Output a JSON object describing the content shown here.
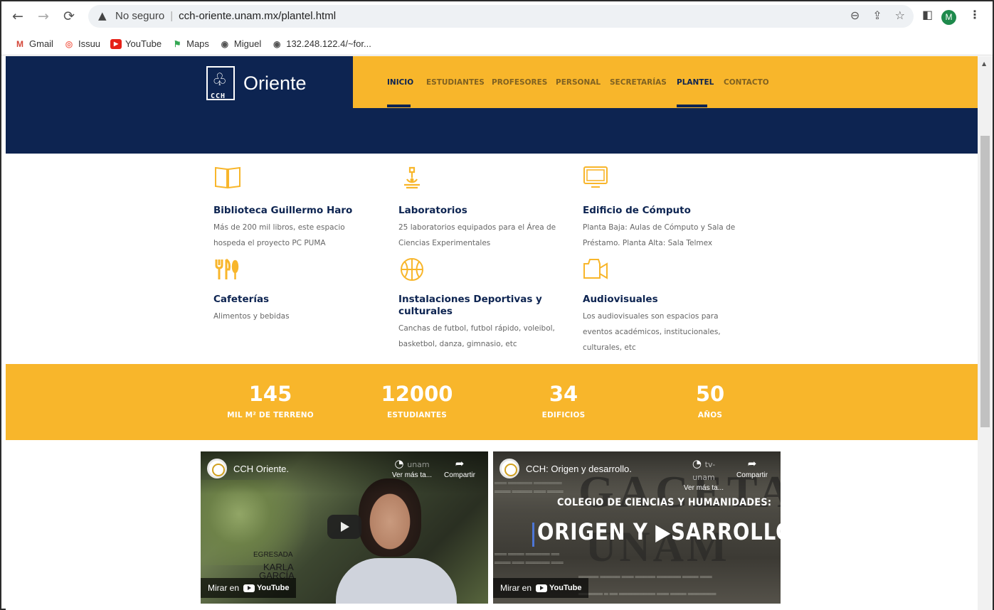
{
  "browser": {
    "security_label": "No seguro",
    "url": "cch-oriente.unam.mx/plantel.html",
    "avatar_letter": "M",
    "bookmarks": [
      {
        "label": "Gmail",
        "icon": "gmail-icon"
      },
      {
        "label": "Issuu",
        "icon": "issuu-icon"
      },
      {
        "label": "YouTube",
        "icon": "youtube-icon"
      },
      {
        "label": "Maps",
        "icon": "maps-icon"
      },
      {
        "label": "Miguel",
        "icon": "globe-icon"
      },
      {
        "label": "132.248.122.4/~for...",
        "icon": "globe-icon"
      }
    ]
  },
  "site": {
    "logo_text": "Oriente",
    "logo_sub": "CCH",
    "nav": [
      {
        "label": "INICIO",
        "active": true
      },
      {
        "label": "ESTUDIANTES",
        "active": false
      },
      {
        "label": "PROFESORES",
        "active": false
      },
      {
        "label": "PERSONAL",
        "active": false
      },
      {
        "label": "SECRETARÍAS",
        "active": false
      },
      {
        "label": "PLANTEL",
        "active": true
      },
      {
        "label": "CONTACTO",
        "active": false
      }
    ]
  },
  "facilities": [
    {
      "icon": "book-icon",
      "title": "Biblioteca Guillermo Haro",
      "desc": [
        "Más de 200 mil libros, este espacio",
        "hospeda el proyecto PC PUMA"
      ]
    },
    {
      "icon": "microscope-icon",
      "title": "Laboratorios",
      "desc": [
        "25 laboratorios equipados para el Área de",
        "Ciencias Experimentales"
      ]
    },
    {
      "icon": "monitor-icon",
      "title": "Edificio de Cómputo",
      "desc": [
        "Planta Baja: Aulas de Cómputo y Sala de",
        "Préstamo. Planta Alta: Sala Telmex"
      ]
    },
    {
      "icon": "cutlery-icon",
      "title": "Cafeterías",
      "desc": [
        "Alimentos y bebidas"
      ]
    },
    {
      "icon": "basketball-icon",
      "title": "Instalaciones Deportivas y culturales",
      "title_lines": [
        "Instalaciones Deportivas y",
        "culturales"
      ],
      "desc": [
        "Canchas de futbol, futbol rápido, voleibol,",
        "basketbol, danza, gimnasio, etc"
      ]
    },
    {
      "icon": "video-camera-icon",
      "title": "Audiovisuales",
      "desc": [
        "Los audiovisuales son espacios para",
        "eventos académicos, institucionales,",
        "culturales, etc"
      ]
    }
  ],
  "stats": [
    {
      "value": "145",
      "label": "MIL M² DE TERRENO"
    },
    {
      "value": "12000",
      "label": "ESTUDIANTES"
    },
    {
      "value": "34",
      "label": "EDIFICIOS"
    },
    {
      "value": "50",
      "label": "AÑOS"
    }
  ],
  "videos": [
    {
      "title": "CCH Oriente.",
      "watch_later_label": "Ver más ta...",
      "channel_label": "unam",
      "share_label": "Compartir",
      "watch_on_label": "Mirar en",
      "youtube_label": "YouTube",
      "overlay_role": "EGRESADA",
      "overlay_name": [
        "KARLA",
        "GARCÍA"
      ]
    },
    {
      "title": "CCH: Origen y desarrollo.",
      "watch_later_label": "Ver más ta...",
      "channel_label": "tv-unam",
      "share_label": "Compartir",
      "watch_on_label": "Mirar en",
      "youtube_label": "YouTube",
      "bg_title_1": "GACETA",
      "bg_title_2": "UNAM",
      "overlay_sub": "COLEGIO DE CIENCIAS Y HUMANIDADES:",
      "overlay_big": "ORIGEN Y ▶SARROLLO."
    }
  ]
}
